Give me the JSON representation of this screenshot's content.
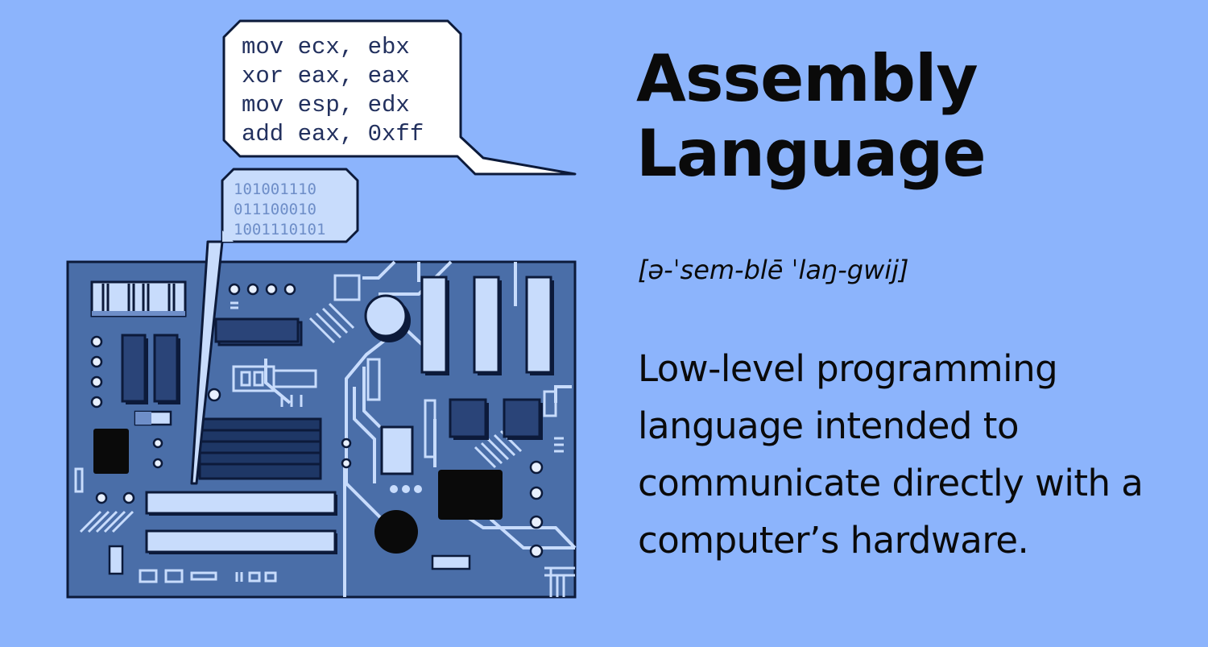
{
  "title": {
    "line1": "Assembly",
    "line2": "Language"
  },
  "pronunciation": "[ə-ˈsem-blē ˈlaŋ-gwij]",
  "definition": "Low-level programming language intended to communicate directly with a computer’s hardware.",
  "assembly_bubble": {
    "lines": [
      "mov ecx, ebx",
      "xor eax, eax",
      "mov esp, edx",
      "add eax, 0xff"
    ]
  },
  "binary_bubble": {
    "lines": [
      "101001110",
      "011100010",
      "1001110101"
    ]
  },
  "colors": {
    "background": "#8cb4fc",
    "board": "#4a6ea8",
    "trace": "#c8dcfc",
    "text": "#0a0a0a"
  }
}
